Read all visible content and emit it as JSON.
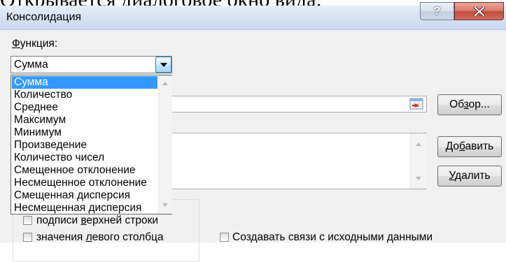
{
  "caption": "Открывается диалоговое окно вида:",
  "dialog": {
    "title": "Консолидация",
    "help_glyph": "?",
    "function_label": {
      "key": "Ф",
      "post": "ункция:"
    },
    "function_value": "Сумма",
    "function_options": [
      "Сумма",
      "Количество",
      "Среднее",
      "Максимум",
      "Минимум",
      "Произведение",
      "Количество чисел",
      "Смещенное отклонение",
      "Несмещенное отклонение",
      "Смещенная дисперсия",
      "Несмещенная дисперсия"
    ],
    "selected_option_index": 0,
    "browse_button": {
      "pre": "Об",
      "key": "з",
      "post": "ор..."
    },
    "add_button": {
      "pre": "До",
      "key": "б",
      "post": "авить"
    },
    "delete_button": {
      "key": "У",
      "post": "далить"
    },
    "checkbox_top_row": {
      "pre": "подписи ",
      "key": "в",
      "post": "ерхней строки",
      "checked": false
    },
    "checkbox_left_column": {
      "pre": "значения ",
      "key": "л",
      "post": "евого столбца",
      "checked": false
    },
    "checkbox_links": {
      "label": "Создавать связи с исходными данными",
      "checked": false
    }
  },
  "icons": {
    "help": "help-icon",
    "close": "close-icon",
    "dropdown": "chevron-down-icon",
    "collapse_dialog": "collapse-dialog-icon",
    "scroll_up": "scroll-up-icon",
    "scroll_down": "scroll-down-icon"
  },
  "colors": {
    "selection": "#3399ff",
    "close_button": "#c24a3b",
    "titlebar": "#d6e3f3",
    "dialog_background": "#f0f0f0"
  }
}
